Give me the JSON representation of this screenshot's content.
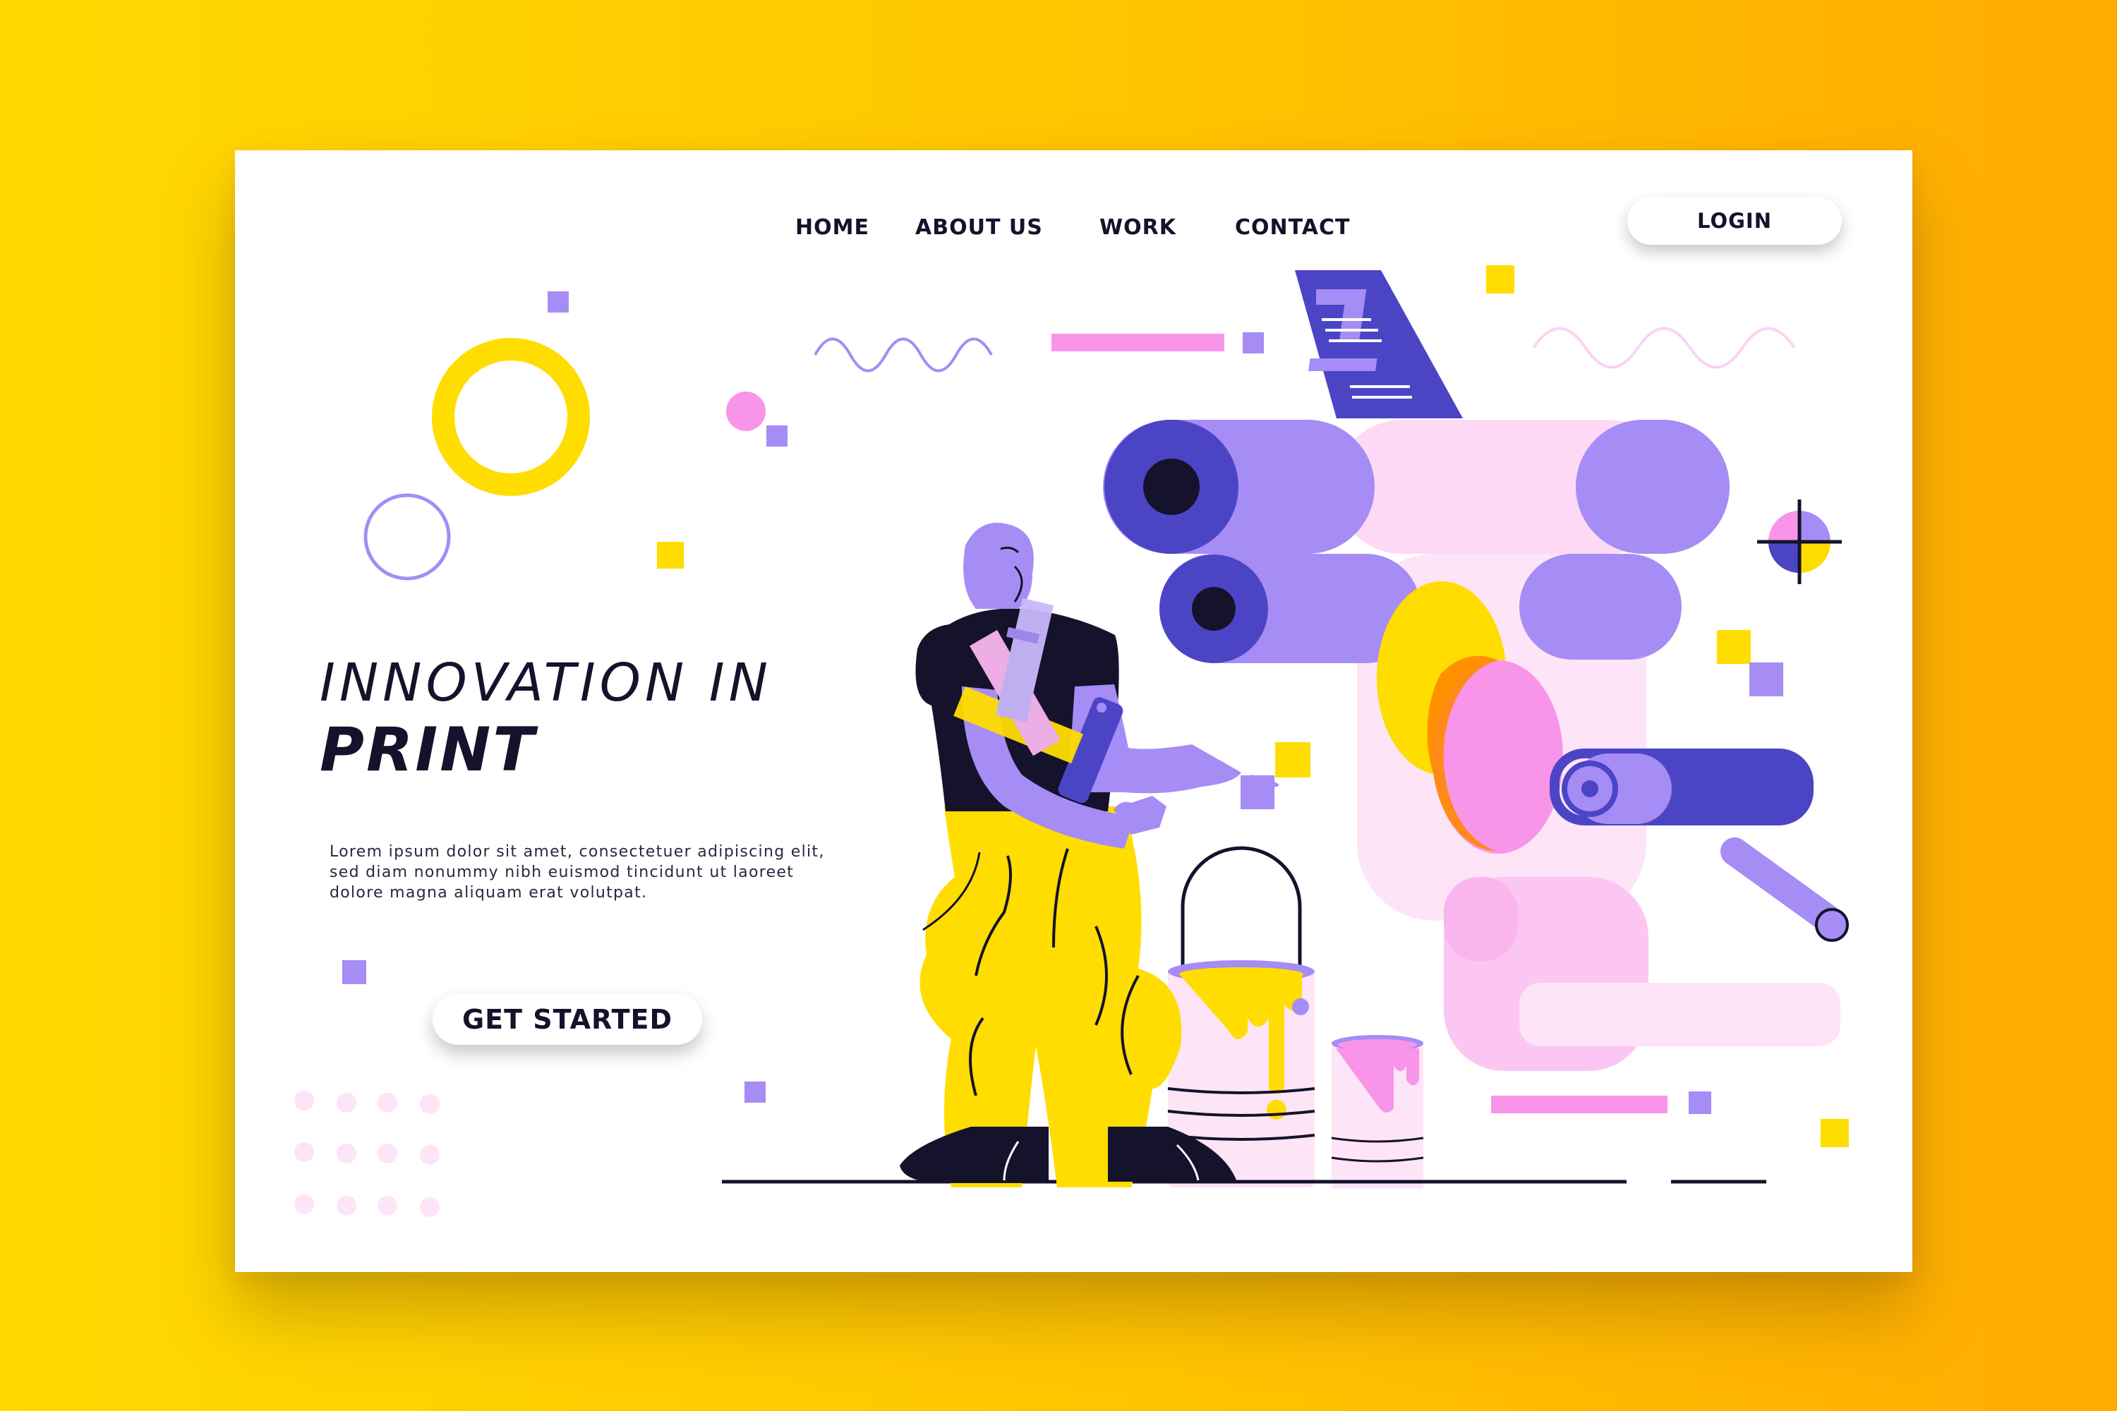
{
  "nav": {
    "links": [
      "HOME",
      "ABOUT US",
      "WORK",
      "CONTACT"
    ],
    "login_label": "LOGIN"
  },
  "hero": {
    "title_line1": "INNOVATION IN",
    "title_line2": "PRINT",
    "paragraph": "Lorem ipsum dolor sit amet, consectetuer adipiscing elit, sed diam nonummy nibh euismod tincidunt ut laoreet dolore magna aliquam erat volutpat.",
    "cta_label": "GET STARTED"
  },
  "icons": [
    "print-roller-icon",
    "paint-bucket-icon",
    "paint-roller-icon",
    "registration-mark-icon",
    "color-swatch-icon",
    "document-sheet-icon"
  ],
  "colors": {
    "background": "#ffd900",
    "accent_yellow": "#ffdd00",
    "accent_purple": "#a68cf5",
    "accent_indigo": "#4b45c6",
    "accent_pink": "#f995e8",
    "dark": "#15122b"
  }
}
